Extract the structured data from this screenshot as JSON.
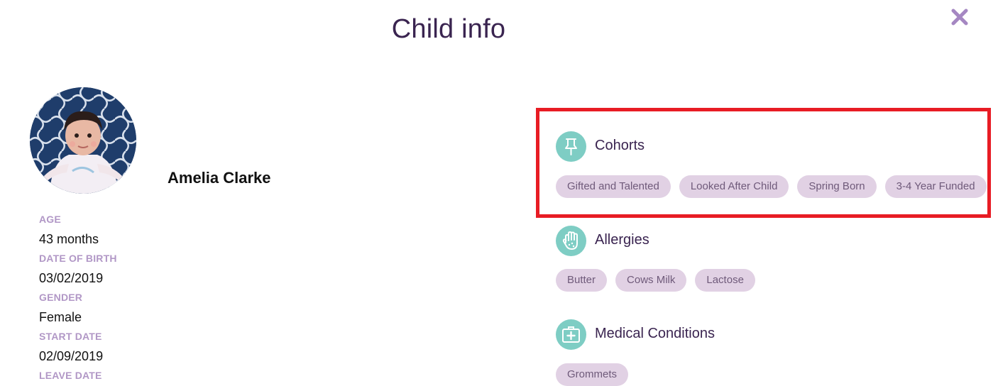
{
  "modal": {
    "title": "Child info",
    "close_icon": "close-icon"
  },
  "child": {
    "name": "Amelia Clarke",
    "avatar": "child-photo",
    "details": [
      {
        "label": "AGE",
        "value": "43 months"
      },
      {
        "label": "DATE OF BIRTH",
        "value": "03/02/2019"
      },
      {
        "label": "GENDER",
        "value": "Female"
      },
      {
        "label": "START DATE",
        "value": "02/09/2019"
      },
      {
        "label": "LEAVE DATE",
        "value": ""
      }
    ]
  },
  "sections": {
    "cohorts": {
      "title": "Cohorts",
      "icon": "pin-icon",
      "items": [
        "Gifted and Talented",
        "Looked After Child",
        "Spring Born",
        "3-4 Year Funded"
      ]
    },
    "allergies": {
      "title": "Allergies",
      "icon": "hand-icon",
      "items": [
        "Butter",
        "Cows Milk",
        "Lactose"
      ]
    },
    "medical": {
      "title": "Medical Conditions",
      "icon": "medical-kit-icon",
      "items": [
        "Grommets"
      ]
    }
  },
  "colors": {
    "title": "#3a2450",
    "label": "#b197c6",
    "icon_bg": "#7ecdc4",
    "chip_bg": "#e1d1e4",
    "chip_text": "#6f5a7a",
    "close": "#a587c2",
    "highlight": "#e81c24"
  }
}
